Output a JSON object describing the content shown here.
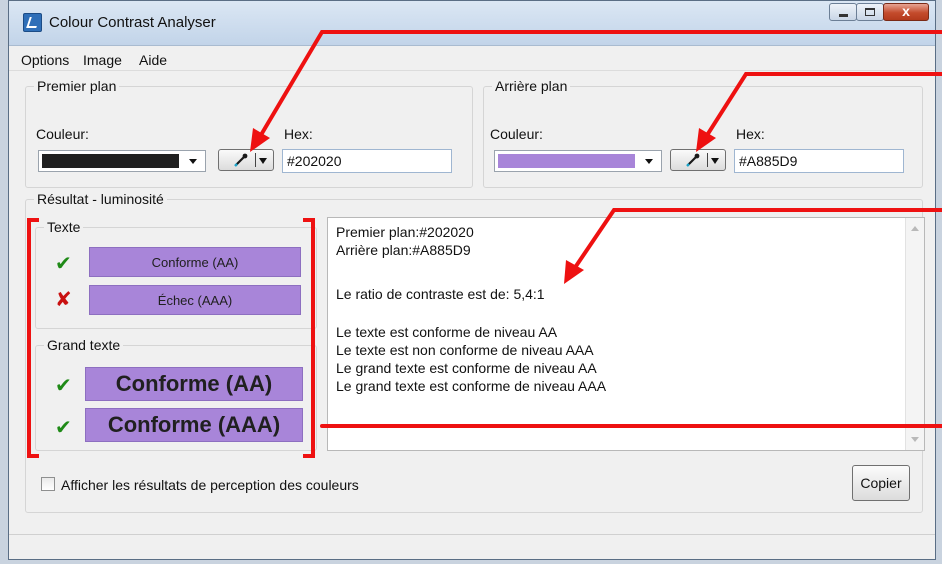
{
  "window": {
    "title": "Colour Contrast Analyser",
    "buttons": [
      "minimize",
      "maximize",
      "close"
    ],
    "close_glyph": "x"
  },
  "menu": [
    "Options",
    "Image",
    "Aide"
  ],
  "foreground": {
    "legend": "Premier plan",
    "color_label": "Couleur:",
    "hex_label": "Hex:",
    "hex_value": "#202020",
    "swatch": "#202020"
  },
  "background": {
    "legend": "Arrière plan",
    "color_label": "Couleur:",
    "hex_label": "Hex:",
    "hex_value": "#A885D9",
    "swatch": "#A885D9"
  },
  "result": {
    "legend": "Résultat - luminosité",
    "text": {
      "legend": "Texte",
      "aa": "Conforme (AA)",
      "aaa": "Échec (AAA)"
    },
    "large_text": {
      "legend": "Grand texte",
      "aa": "Conforme (AA)",
      "aaa": "Conforme (AAA)"
    },
    "report": [
      "Premier plan:#202020",
      "Arrière plan:#A885D9",
      "",
      "Le ratio de contraste est de: 5,4:1",
      "",
      "Le texte est conforme de niveau AA",
      "Le texte est non conforme de niveau AAA",
      "Le grand texte est conforme de niveau AA",
      "Le grand texte est conforme de niveau AAA"
    ]
  },
  "colorblind_checkbox": "Afficher les résultats de perception des couleurs",
  "copy_button": "Copier",
  "colors": {
    "pass": "#1f8a17",
    "fail": "#c91010",
    "annotation": "#ee1111",
    "result_bg": "#A885D9"
  },
  "icons": {
    "app": "ccа-app-icon",
    "picker": "eyedropper-icon",
    "pass": "check-icon",
    "fail": "cross-icon"
  }
}
